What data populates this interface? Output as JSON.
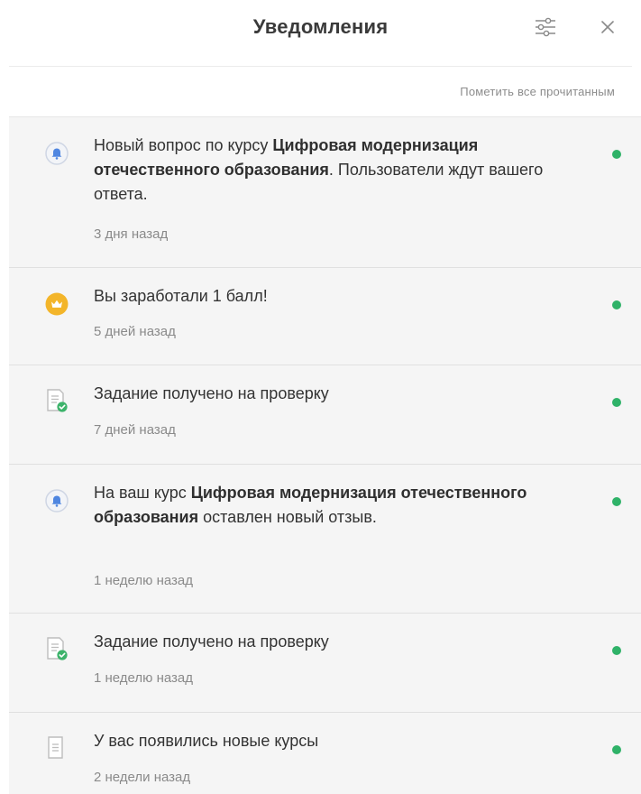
{
  "header": {
    "title": "Уведомления",
    "filter_icon": "sliders-icon",
    "close_icon": "close-icon"
  },
  "mark_all_label": "Пометить все прочитанным",
  "accent_unread": "#2fb268",
  "notifications": [
    {
      "icon": "bell-icon",
      "segments": [
        {
          "text": "Новый вопрос по курсу ",
          "bold": false
        },
        {
          "text": "Цифровая модернизация отечественного образования",
          "bold": true
        },
        {
          "text": ". Пользователи ждут вашего ответа.",
          "bold": false
        }
      ],
      "time": "3 дня назад",
      "unread": true
    },
    {
      "icon": "crown-icon",
      "segments": [
        {
          "text": "Вы заработали 1 балл!",
          "bold": false
        }
      ],
      "time": "5 дней назад",
      "unread": true
    },
    {
      "icon": "document-check-icon",
      "segments": [
        {
          "text": "Задание получено на проверку",
          "bold": false
        }
      ],
      "time": "7 дней назад",
      "unread": true
    },
    {
      "icon": "bell-icon",
      "segments": [
        {
          "text": "На ваш курс ",
          "bold": false
        },
        {
          "text": "Цифровая модернизация отечественного образования",
          "bold": true
        },
        {
          "text": " оставлен новый отзыв.",
          "bold": false
        }
      ],
      "time": "1 неделю назад",
      "unread": true
    },
    {
      "icon": "document-check-icon",
      "segments": [
        {
          "text": "Задание получено на проверку",
          "bold": false
        }
      ],
      "time": "1 неделю назад",
      "unread": true
    },
    {
      "icon": "document-icon",
      "segments": [
        {
          "text": "У вас появились новые курсы",
          "bold": false
        }
      ],
      "time": "2 недели назад",
      "unread": true
    }
  ]
}
